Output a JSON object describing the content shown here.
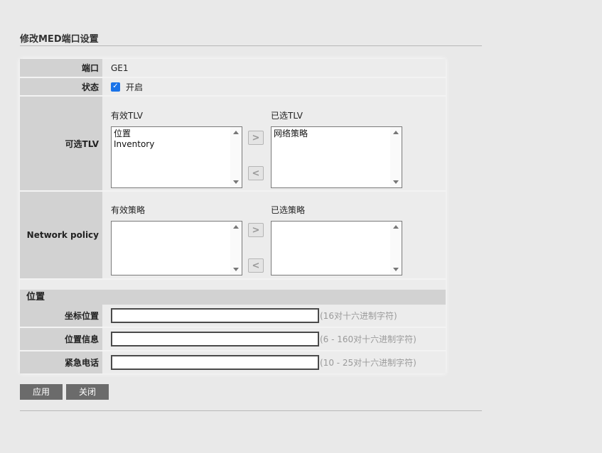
{
  "page": {
    "title": "修改MED端口设置"
  },
  "form": {
    "port": {
      "label": "端口",
      "value": "GE1"
    },
    "status": {
      "label": "状态",
      "checkbox_label": "开启",
      "checked": true
    },
    "tlv": {
      "label": "可选TLV",
      "available_title": "有效TLV",
      "selected_title": "已选TLV",
      "available_items": [
        "位置",
        "Inventory"
      ],
      "selected_items": [
        "网络策略"
      ]
    },
    "policy": {
      "label": "Network policy",
      "available_title": "有效策略",
      "selected_title": "已选策略",
      "available_items": [],
      "selected_items": []
    },
    "location_section": {
      "title": "位置"
    },
    "coordinates": {
      "label": "坐标位置",
      "value": "",
      "hint": "(16对十六进制字符)"
    },
    "location_info": {
      "label": "位置信息",
      "value": "",
      "hint": "(6 - 160对十六进制字符)"
    },
    "emergency_phone": {
      "label": "紧急电话",
      "value": "",
      "hint": "(10 - 25对十六进制字符)"
    }
  },
  "icons": {
    "move_right": ">",
    "move_left": "<",
    "check": "✓"
  },
  "actions": {
    "apply_label": "应用",
    "close_label": "关闭"
  }
}
